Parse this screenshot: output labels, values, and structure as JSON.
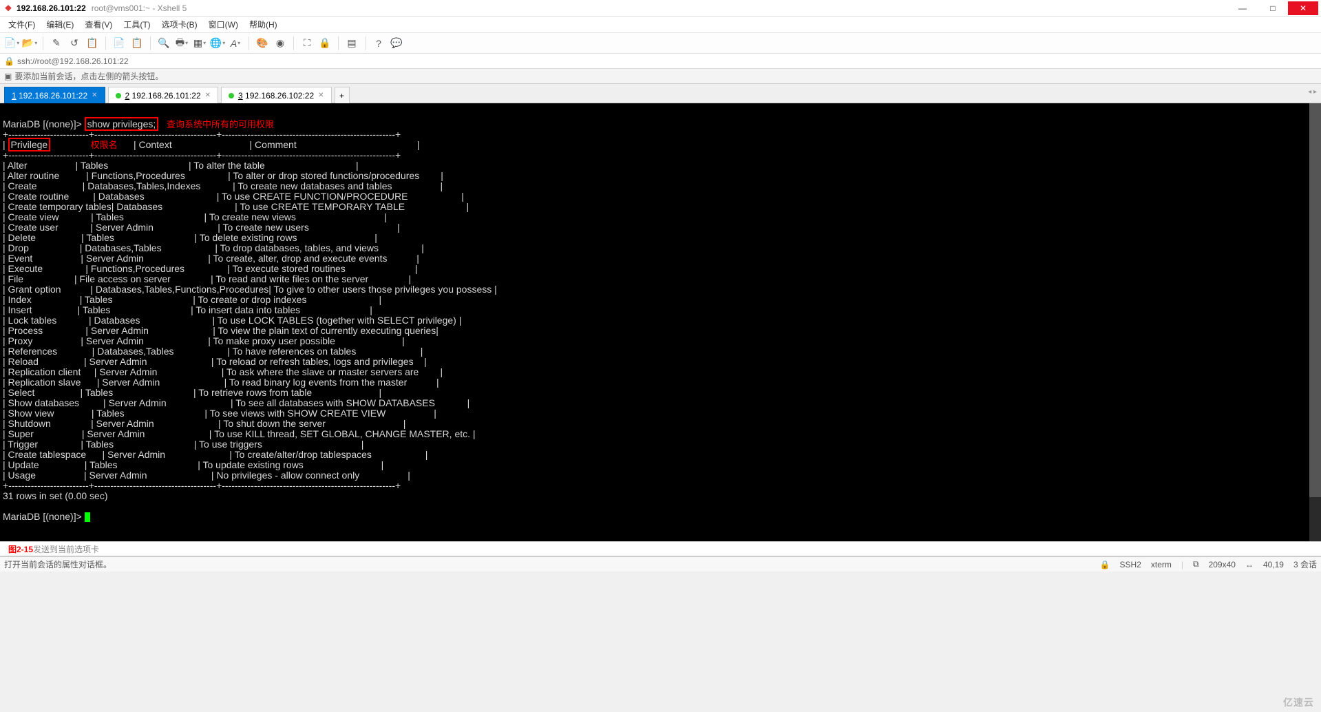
{
  "window": {
    "iconGlyph": "❖",
    "activeTitle": "192.168.26.101:22",
    "subTitle": "root@vms001:~ - Xshell 5",
    "btnMin": "—",
    "btnMax": "□",
    "btnClose": "✕"
  },
  "menu": {
    "file": "文件(F)",
    "edit": "编辑(E)",
    "view": "查看(V)",
    "tools": "工具(T)",
    "tabs": "选项卡(B)",
    "window": "窗口(W)",
    "help": "帮助(H)"
  },
  "address": {
    "iconGlyph": "🔒",
    "text": "ssh://root@192.168.26.101:22"
  },
  "hint": {
    "iconGlyph": "▣",
    "text": "要添加当前会话，点击左侧的箭头按钮。"
  },
  "tabs": {
    "items": [
      {
        "num": "1",
        "label": "192.168.26.101:22",
        "active": true
      },
      {
        "num": "2",
        "label": "192.168.26.101:22",
        "active": false
      },
      {
        "num": "3",
        "label": "192.168.26.102:22",
        "active": false
      }
    ],
    "addGlyph": "+",
    "navGlyph": "◂ ▸"
  },
  "terminal": {
    "prompt": "MariaDB [(none)]>",
    "command": "show privileges;",
    "annCmd": "查询系统中所有的可用权限",
    "annCol": "权限名",
    "headers": {
      "c1": "Privilege",
      "c2": "Context",
      "c3": "Comment"
    },
    "rows": [
      {
        "c1": "Alter",
        "c2": "Tables",
        "c3": "To alter the table"
      },
      {
        "c1": "Alter routine",
        "c2": "Functions,Procedures",
        "c3": "To alter or drop stored functions/procedures"
      },
      {
        "c1": "Create",
        "c2": "Databases,Tables,Indexes",
        "c3": "To create new databases and tables"
      },
      {
        "c1": "Create routine",
        "c2": "Databases",
        "c3": "To use CREATE FUNCTION/PROCEDURE"
      },
      {
        "c1": "Create temporary tables",
        "c2": "Databases",
        "c3": "To use CREATE TEMPORARY TABLE"
      },
      {
        "c1": "Create view",
        "c2": "Tables",
        "c3": "To create new views"
      },
      {
        "c1": "Create user",
        "c2": "Server Admin",
        "c3": "To create new users"
      },
      {
        "c1": "Delete",
        "c2": "Tables",
        "c3": "To delete existing rows"
      },
      {
        "c1": "Drop",
        "c2": "Databases,Tables",
        "c3": "To drop databases, tables, and views"
      },
      {
        "c1": "Event",
        "c2": "Server Admin",
        "c3": "To create, alter, drop and execute events"
      },
      {
        "c1": "Execute",
        "c2": "Functions,Procedures",
        "c3": "To execute stored routines"
      },
      {
        "c1": "File",
        "c2": "File access on server",
        "c3": "To read and write files on the server"
      },
      {
        "c1": "Grant option",
        "c2": "Databases,Tables,Functions,Procedures",
        "c3": "To give to other users those privileges you possess"
      },
      {
        "c1": "Index",
        "c2": "Tables",
        "c3": "To create or drop indexes"
      },
      {
        "c1": "Insert",
        "c2": "Tables",
        "c3": "To insert data into tables"
      },
      {
        "c1": "Lock tables",
        "c2": "Databases",
        "c3": "To use LOCK TABLES (together with SELECT privilege)"
      },
      {
        "c1": "Process",
        "c2": "Server Admin",
        "c3": "To view the plain text of currently executing queries"
      },
      {
        "c1": "Proxy",
        "c2": "Server Admin",
        "c3": "To make proxy user possible"
      },
      {
        "c1": "References",
        "c2": "Databases,Tables",
        "c3": "To have references on tables"
      },
      {
        "c1": "Reload",
        "c2": "Server Admin",
        "c3": "To reload or refresh tables, logs and privileges"
      },
      {
        "c1": "Replication client",
        "c2": "Server Admin",
        "c3": "To ask where the slave or master servers are"
      },
      {
        "c1": "Replication slave",
        "c2": "Server Admin",
        "c3": "To read binary log events from the master"
      },
      {
        "c1": "Select",
        "c2": "Tables",
        "c3": "To retrieve rows from table"
      },
      {
        "c1": "Show databases",
        "c2": "Server Admin",
        "c3": "To see all databases with SHOW DATABASES"
      },
      {
        "c1": "Show view",
        "c2": "Tables",
        "c3": "To see views with SHOW CREATE VIEW"
      },
      {
        "c1": "Shutdown",
        "c2": "Server Admin",
        "c3": "To shut down the server"
      },
      {
        "c1": "Super",
        "c2": "Server Admin",
        "c3": "To use KILL thread, SET GLOBAL, CHANGE MASTER, etc."
      },
      {
        "c1": "Trigger",
        "c2": "Tables",
        "c3": "To use triggers"
      },
      {
        "c1": "Create tablespace",
        "c2": "Server Admin",
        "c3": "To create/alter/drop tablespaces"
      },
      {
        "c1": "Update",
        "c2": "Tables",
        "c3": "To update existing rows"
      },
      {
        "c1": "Usage",
        "c2": "Server Admin",
        "c3": "No privileges - allow connect only"
      }
    ],
    "footer": "31 rows in set (0.00 sec)"
  },
  "input": {
    "placeholder": "发送到当前选项卡",
    "figLabel": "图2-15"
  },
  "status": {
    "left": "打开当前会话的属性对话框。",
    "ssh": "SSH2",
    "term": "xterm",
    "size": "209x40",
    "pos": "40,19",
    "sess": "3 会话",
    "sizeIcon": "⧉",
    "posIcon": "↔",
    "lockIcon": "🔒",
    "caps": "",
    "num": ""
  },
  "watermark": "亿速云",
  "chart_data": {
    "type": "table",
    "title": "MariaDB privileges",
    "columns": [
      "Privilege",
      "Context",
      "Comment"
    ],
    "rows_ref": "terminal.rows"
  }
}
